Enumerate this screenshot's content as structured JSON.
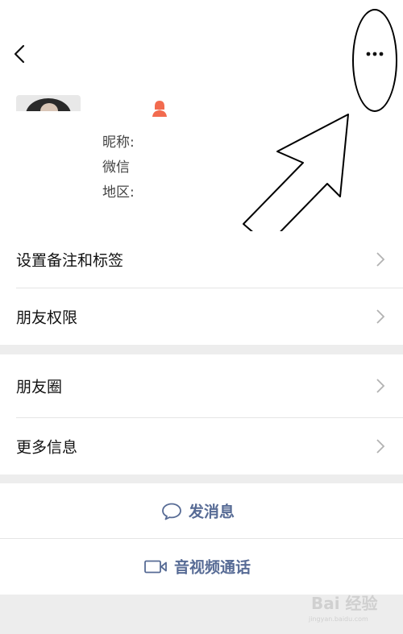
{
  "header": {
    "back_icon": "chevron-left-icon",
    "more_icon": "more-horizontal-icon"
  },
  "profile": {
    "gender_icon": "female-user-icon",
    "gender_color": "#f26b4f",
    "nickname_label": "昵称:",
    "wechat_label": "微信",
    "region_label": "地区:"
  },
  "menu": {
    "section1": [
      {
        "label": "设置备注和标签"
      },
      {
        "label": "朋友权限"
      }
    ],
    "section2": [
      {
        "label": "朋友圈"
      },
      {
        "label": "更多信息"
      }
    ]
  },
  "actions": {
    "message_label": "发消息",
    "call_label": "音视频通话",
    "accent": "#576b95"
  },
  "watermark": {
    "brand": "Bai 经验",
    "url": "jingyan.baidu.com"
  }
}
